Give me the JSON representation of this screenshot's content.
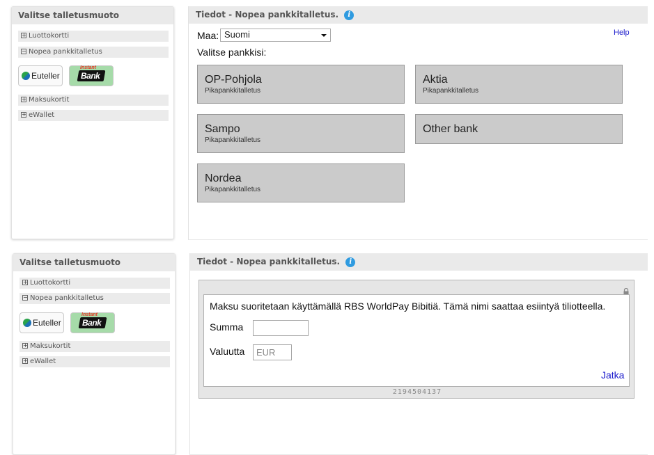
{
  "top": {
    "left_panel": {
      "title": "Valitse talletusmuoto",
      "methods": [
        {
          "label": "Luottokortti",
          "state": "+"
        },
        {
          "label": "Nopea pankkitalletus",
          "state": "−"
        },
        {
          "label": "Maksukortit",
          "state": "+"
        },
        {
          "label": "eWallet",
          "state": "+"
        }
      ],
      "logos": {
        "euteller": "Euteller",
        "instant_top": "Instant",
        "instant_bank": "Bank"
      }
    },
    "right_panel": {
      "title": "Tiedot - Nopea pankkitalletus.",
      "info_icon": "i",
      "help_link": "Help",
      "country_label": "Maa:",
      "country_value": "Suomi",
      "choose_bank_label": "Valitse pankkisi:",
      "banks": [
        {
          "name": "OP-Pohjola",
          "sub": "Pikapankkitalletus"
        },
        {
          "name": "Aktia",
          "sub": "Pikapankkitalletus"
        },
        {
          "name": "Sampo",
          "sub": "Pikapankkitalletus"
        },
        {
          "name": "Other bank",
          "sub": ""
        },
        {
          "name": "Nordea",
          "sub": "Pikapankkitalletus"
        }
      ]
    }
  },
  "bottom": {
    "left_panel": {
      "title": "Valitse talletusmuoto",
      "methods": [
        {
          "label": "Luottokortti",
          "state": "+"
        },
        {
          "label": "Nopea pankkitalletus",
          "state": "−"
        },
        {
          "label": "Maksukortit",
          "state": "+"
        },
        {
          "label": "eWallet",
          "state": "+"
        }
      ],
      "logos": {
        "euteller": "Euteller",
        "instant_top": "Instant",
        "instant_bank": "Bank"
      }
    },
    "right_panel": {
      "title": "Tiedot - Nopea pankkitalletus.",
      "info_icon": "i",
      "form": {
        "notice": "Maksu suoritetaan käyttämällä RBS WorldPay Bibitiä. Tämä nimi saattaa esiintyä tiliotteella.",
        "amount_label": "Summa",
        "amount_value": "",
        "currency_label": "Valuutta",
        "currency_value": "EUR",
        "continue_link": "Jatka",
        "reference": "2194504137",
        "lock_icon": "lock-icon"
      }
    }
  },
  "colors": {
    "header_bg": "#eaeaea",
    "bank_box_bg": "#cbcbcb",
    "link": "#1a1acc",
    "info_icon": "#2f9be0",
    "instant_bank_bg": "#a6dba9"
  }
}
